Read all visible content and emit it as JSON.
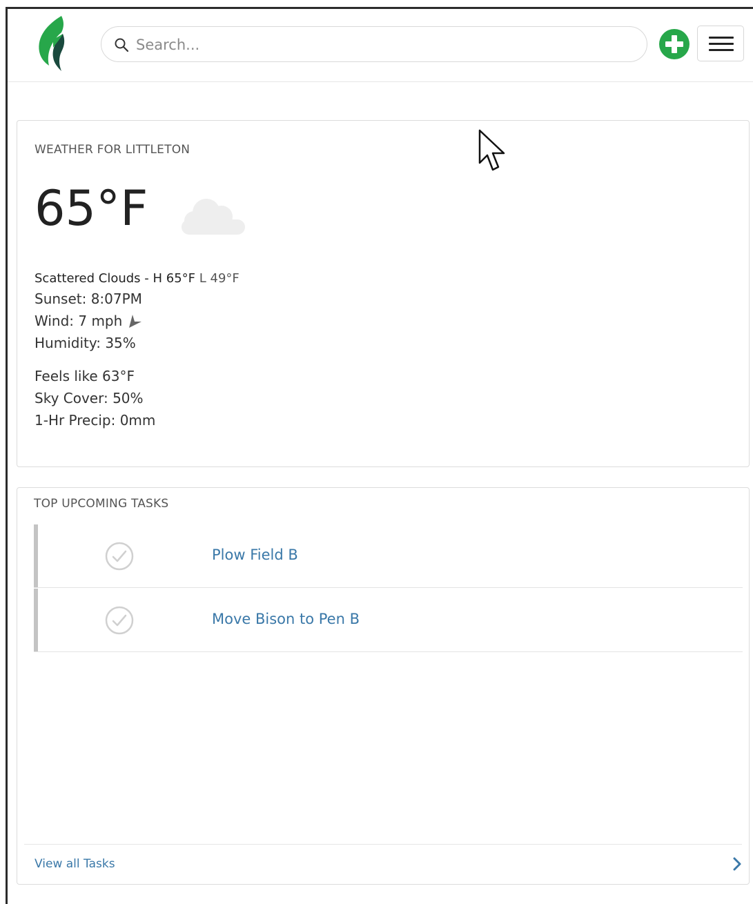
{
  "header": {
    "search_placeholder": "Search...",
    "icons": {
      "logo": "leaf-logo",
      "search": "search-icon",
      "add": "plus-circle-icon",
      "menu": "hamburger-menu-icon"
    }
  },
  "colors": {
    "brand_green": "#27a74a",
    "brand_dark": "#1a4a3e",
    "link_blue": "#3a78a8"
  },
  "weather": {
    "title": "WEATHER FOR LITTLETON",
    "temperature": "65°F",
    "condition_icon": "cloud-icon",
    "summary_condition": "Scattered Clouds - H 65°F",
    "summary_low": " L 49°F",
    "sunset": "Sunset: 8:07PM",
    "wind": "Wind: 7 mph",
    "wind_icon": "wind-direction-arrow-icon",
    "humidity": "Humidity: 35%",
    "feels_like": "Feels like 63°F",
    "sky_cover": "Sky Cover: 50%",
    "precip": "1-Hr Precip: 0mm"
  },
  "tasks": {
    "title": "TOP UPCOMING TASKS",
    "items": [
      {
        "label": "Plow Field B"
      },
      {
        "label": "Move Bison to Pen B"
      }
    ],
    "view_all": "View all Tasks"
  }
}
